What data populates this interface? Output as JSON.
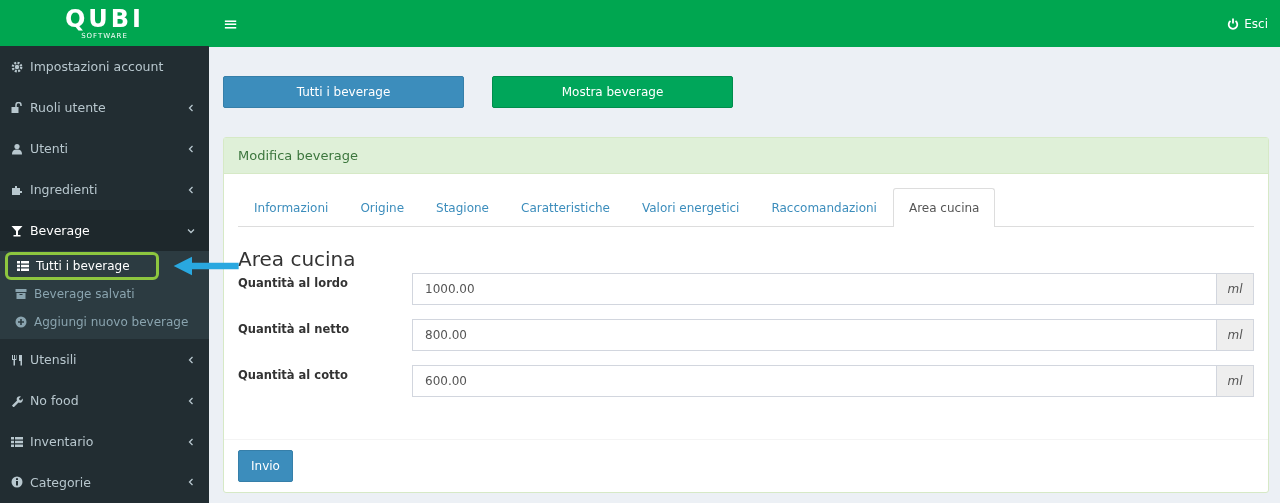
{
  "logo": {
    "name": "QUBI",
    "tagline": "SOFTWARE"
  },
  "header": {
    "menu_icon": "≡",
    "logout": "Esci"
  },
  "sidebar": {
    "items": [
      {
        "label": "Impostazioni account",
        "kind": "gear",
        "expandable": false,
        "expanded": false
      },
      {
        "label": "Ruoli utente",
        "kind": "unlock",
        "expandable": true,
        "expanded": false
      },
      {
        "label": "Utenti",
        "kind": "user",
        "expandable": true,
        "expanded": false
      },
      {
        "label": "Ingredienti",
        "kind": "puzzle",
        "expandable": true,
        "expanded": false
      },
      {
        "label": "Beverage",
        "kind": "glass",
        "expandable": true,
        "expanded": true,
        "children": [
          {
            "label": "Tutti i beverage",
            "kind": "list",
            "selected": true,
            "highlighted": true
          },
          {
            "label": "Beverage salvati",
            "kind": "archive",
            "selected": false,
            "highlighted": false
          },
          {
            "label": "Aggiungi nuovo beverage",
            "kind": "plus",
            "selected": false,
            "highlighted": false
          }
        ]
      },
      {
        "label": "Utensili",
        "kind": "cutlery",
        "expandable": true,
        "expanded": false
      },
      {
        "label": "No food",
        "kind": "wrench",
        "expandable": true,
        "expanded": false
      },
      {
        "label": "Inventario",
        "kind": "list",
        "expandable": true,
        "expanded": false
      },
      {
        "label": "Categorie",
        "kind": "info",
        "expandable": true,
        "expanded": false
      }
    ]
  },
  "actions": [
    {
      "label": "Tutti i beverage",
      "kind": "primary"
    },
    {
      "label": "Mostra beverage",
      "kind": "success"
    }
  ],
  "panel": {
    "title": "Modifica beverage",
    "tabs": [
      {
        "label": "Informazioni",
        "selected": false
      },
      {
        "label": "Origine",
        "selected": false
      },
      {
        "label": "Stagione",
        "selected": false
      },
      {
        "label": "Caratteristiche",
        "selected": false
      },
      {
        "label": "Valori energetici",
        "selected": false
      },
      {
        "label": "Raccomandazioni",
        "selected": false
      },
      {
        "label": "Area cucina",
        "selected": true
      }
    ],
    "section_title": "Area cucina",
    "fields": [
      {
        "label": "Quantità al lordo",
        "value": "1000.00",
        "unit": "ml"
      },
      {
        "label": "Quantità al netto",
        "value": "800.00",
        "unit": "ml"
      },
      {
        "label": "Quantità al cotto",
        "value": "600.00",
        "unit": "ml"
      }
    ],
    "submit": "Invio"
  }
}
